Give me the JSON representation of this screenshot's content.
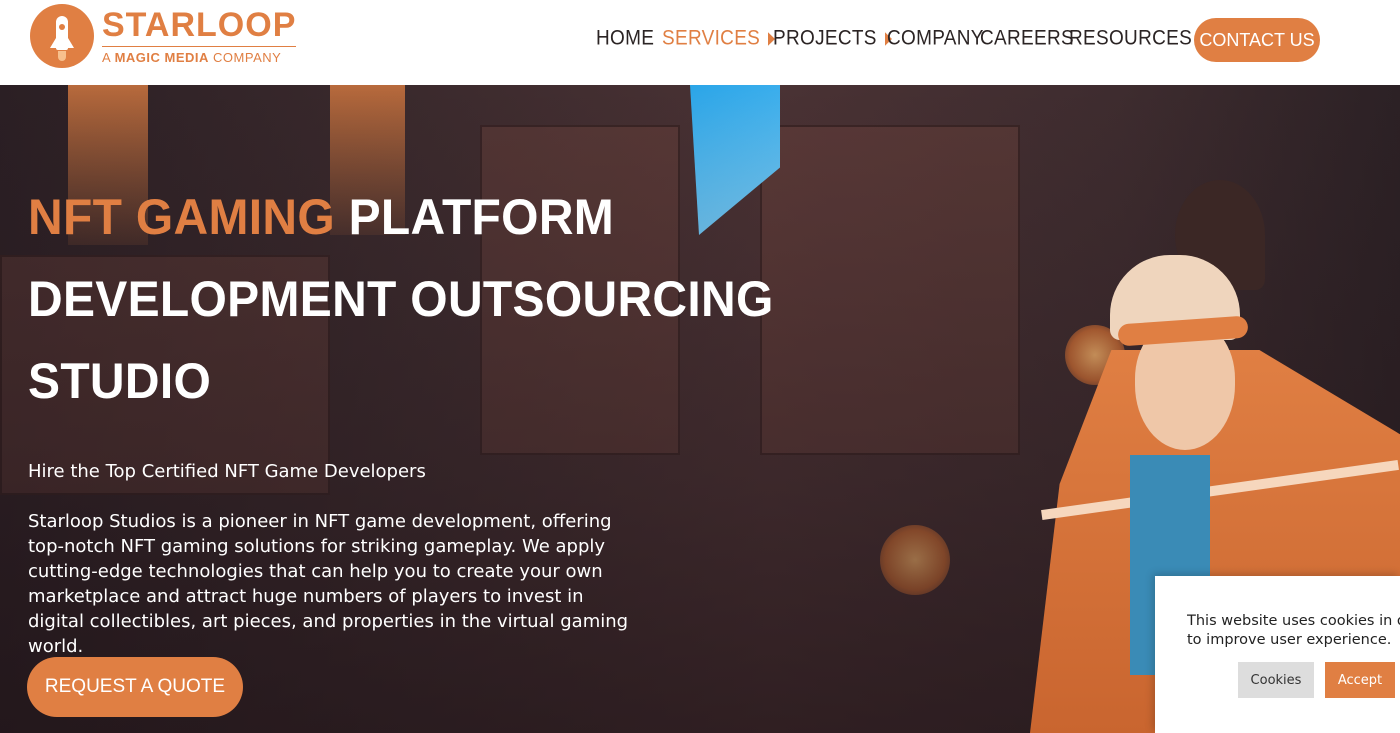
{
  "brand": {
    "name": "STARLOOP",
    "tagline_prefix": "A ",
    "tagline_bold": "MAGIC MEDIA",
    "tagline_suffix": " COMPANY"
  },
  "nav": {
    "items": [
      {
        "label": "HOME"
      },
      {
        "label": "SERVICES"
      },
      {
        "label": "PROJECTS"
      },
      {
        "label": "COMPANY"
      },
      {
        "label": "CAREERS"
      },
      {
        "label": "RESOURCES"
      }
    ],
    "contact_label": "CONTACT US"
  },
  "hero": {
    "title_accent": "NFT GAMING",
    "title_line1_rest": " PLATFORM",
    "title_line2": "DEVELOPMENT OUTSOURCING",
    "title_line3": "STUDIO",
    "subtitle": "Hire the Top Certified NFT Game Developers",
    "paragraph": "Starloop Studios is a pioneer in NFT game development, offering top-notch NFT gaming solutions for striking gameplay. We apply cutting-edge technologies that can help you to create your own marketplace and attract huge numbers of players to invest in digital collectibles, art pieces, and properties in the virtual gaming world.",
    "cta_label": "REQUEST A QUOTE"
  },
  "cookie": {
    "line1": "This website uses cookies in o",
    "line2": "to improve user experience.",
    "settings_label": "Cookies",
    "accept_label": "Accept"
  },
  "colors": {
    "accent": "#e07f43",
    "nav_text": "#2b2424"
  }
}
